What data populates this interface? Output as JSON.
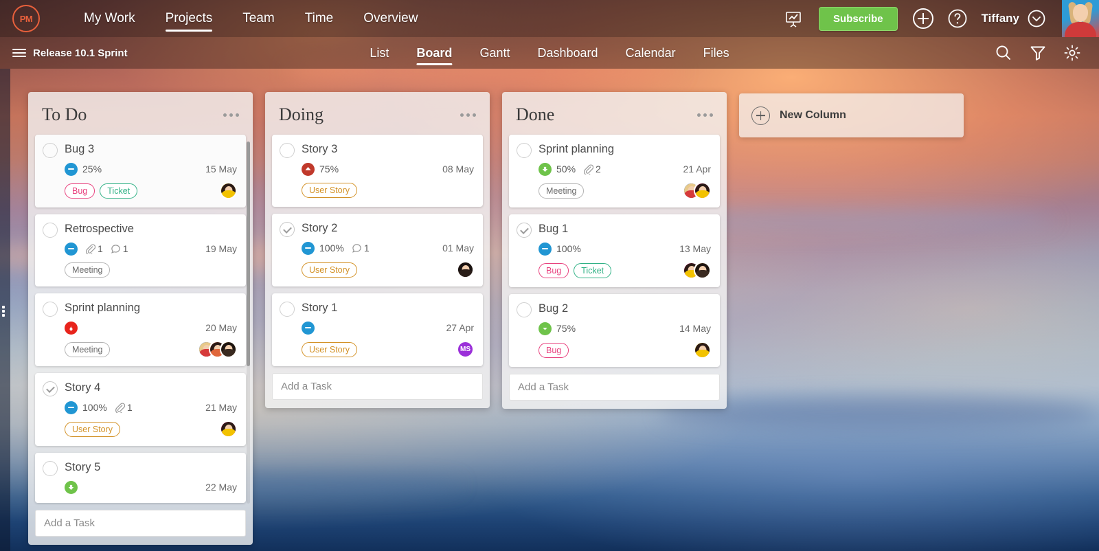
{
  "app": {
    "logo_text": "PM",
    "background": "sunset-sky-photo"
  },
  "topnav": {
    "items": [
      {
        "label": "My Work",
        "active": false
      },
      {
        "label": "Projects",
        "active": true
      },
      {
        "label": "Team",
        "active": false
      },
      {
        "label": "Time",
        "active": false
      },
      {
        "label": "Overview",
        "active": false
      }
    ],
    "report_icon": "presentation-chart-icon",
    "subscribe_label": "Subscribe",
    "add_icon": "plus-circle-icon",
    "help_icon": "question-circle-icon",
    "username": "Tiffany",
    "user_chevron_icon": "chevron-down-circle-icon",
    "avatar_icon": "user-avatar"
  },
  "projectbar": {
    "menu_icon": "hamburger-icon",
    "project_title": "Release 10.1 Sprint",
    "tabs": [
      {
        "label": "List",
        "active": false
      },
      {
        "label": "Board",
        "active": true
      },
      {
        "label": "Gantt",
        "active": false
      },
      {
        "label": "Dashboard",
        "active": false
      },
      {
        "label": "Calendar",
        "active": false
      },
      {
        "label": "Files",
        "active": false
      }
    ],
    "search_icon": "search-icon",
    "filter_icon": "filter-funnel-icon",
    "settings_icon": "gear-icon"
  },
  "board": {
    "add_task_placeholder": "Add a Task",
    "new_column": {
      "label": "New Column",
      "icon": "plus-circle-icon"
    },
    "columns": [
      {
        "title": "To Do",
        "menu_icon": "more-dots-icon",
        "has_scrollbar": true,
        "cards": [
          {
            "title": "Bug 3",
            "completed": false,
            "tinted": true,
            "priority": {
              "name": "medium",
              "icon": "minus-circle-icon",
              "color": "#2196d3"
            },
            "progress": "25%",
            "attachments": null,
            "comments": null,
            "date": "15 May",
            "tags": [
              {
                "label": "Bug",
                "style": "bug"
              },
              {
                "label": "Ticket",
                "style": "ticket"
              }
            ],
            "avatars": [
              {
                "type": "photo",
                "hair": "#2b1a16",
                "shirt": "#f2c200",
                "bg": "#f2c200"
              }
            ]
          },
          {
            "title": "Retrospective",
            "completed": false,
            "tinted": false,
            "priority": {
              "name": "medium",
              "icon": "minus-circle-icon",
              "color": "#2196d3"
            },
            "progress": null,
            "attachments": "1",
            "comments": "1",
            "date": "19 May",
            "tags": [
              {
                "label": "Meeting",
                "style": "meeting"
              }
            ],
            "avatars": []
          },
          {
            "title": "Sprint planning",
            "completed": false,
            "tinted": false,
            "priority": {
              "name": "critical",
              "icon": "flame-circle-icon",
              "color": "#e8241c"
            },
            "progress": null,
            "attachments": null,
            "comments": null,
            "date": "20 May",
            "tags": [
              {
                "label": "Meeting",
                "style": "meeting"
              }
            ],
            "avatars": [
              {
                "type": "photo",
                "hair": "#e8c98a",
                "shirt": "#d63a3a",
                "bg": "#4a6fa5"
              },
              {
                "type": "photo",
                "hair": "#2b1a16",
                "shirt": "#e0663a",
                "bg": "#e0663a"
              },
              {
                "type": "photo",
                "hair": "#1d1410",
                "shirt": "#3a2a20",
                "bg": "#caa25a"
              }
            ]
          },
          {
            "title": "Story 4",
            "completed": true,
            "tinted": false,
            "priority": {
              "name": "medium",
              "icon": "minus-circle-icon",
              "color": "#2196d3"
            },
            "progress": "100%",
            "attachments": "1",
            "comments": null,
            "date": "21 May",
            "tags": [
              {
                "label": "User Story",
                "style": "userstory"
              }
            ],
            "avatars": [
              {
                "type": "photo",
                "hair": "#2b1a16",
                "shirt": "#f2c200",
                "bg": "#e8247e"
              }
            ]
          },
          {
            "title": "Story 5",
            "completed": false,
            "tinted": false,
            "priority": {
              "name": "low",
              "icon": "arrow-down-circle-icon",
              "color": "#6fc34a"
            },
            "progress": null,
            "attachments": null,
            "comments": null,
            "date": "22 May",
            "tags": [],
            "avatars": []
          }
        ]
      },
      {
        "title": "Doing",
        "menu_icon": "more-dots-icon",
        "has_scrollbar": false,
        "cards": [
          {
            "title": "Story 3",
            "completed": false,
            "tinted": false,
            "priority": {
              "name": "high",
              "icon": "arrow-up-circle-icon",
              "color": "#c0392b"
            },
            "progress": "75%",
            "attachments": null,
            "comments": null,
            "date": "08 May",
            "tags": [
              {
                "label": "User Story",
                "style": "userstory"
              }
            ],
            "avatars": []
          },
          {
            "title": "Story 2",
            "completed": true,
            "tinted": false,
            "priority": {
              "name": "medium",
              "icon": "minus-circle-icon",
              "color": "#2196d3"
            },
            "progress": "100%",
            "attachments": null,
            "comments": "1",
            "date": "01 May",
            "tags": [
              {
                "label": "User Story",
                "style": "userstory"
              }
            ],
            "avatars": [
              {
                "type": "photo",
                "hair": "#1a1210",
                "shirt": "#2a1d18",
                "bg": "#3a2820"
              }
            ]
          },
          {
            "title": "Story 1",
            "completed": false,
            "tinted": false,
            "priority": {
              "name": "medium",
              "icon": "minus-circle-icon",
              "color": "#2196d3"
            },
            "progress": null,
            "attachments": null,
            "comments": null,
            "date": "27 Apr",
            "tags": [
              {
                "label": "User Story",
                "style": "userstory"
              }
            ],
            "avatars": [
              {
                "type": "initials",
                "initials": "MS",
                "bg": "#9b30d9"
              }
            ]
          }
        ]
      },
      {
        "title": "Done",
        "menu_icon": "more-dots-icon",
        "has_scrollbar": false,
        "cards": [
          {
            "title": "Sprint planning",
            "completed": false,
            "tinted": false,
            "priority": {
              "name": "lowish",
              "icon": "arrow-down-circle-icon",
              "color": "#6fc34a"
            },
            "progress": "50%",
            "attachments": "2",
            "comments": null,
            "date": "21 Apr",
            "tags": [
              {
                "label": "Meeting",
                "style": "meeting"
              }
            ],
            "avatars": [
              {
                "type": "photo",
                "hair": "#e8c98a",
                "shirt": "#d63a3a",
                "bg": "#4a6fa5"
              },
              {
                "type": "photo",
                "hair": "#2b1a16",
                "shirt": "#f2c200",
                "bg": "#e8247e"
              }
            ]
          },
          {
            "title": "Bug 1",
            "completed": true,
            "tinted": false,
            "priority": {
              "name": "medium",
              "icon": "minus-circle-icon",
              "color": "#2196d3"
            },
            "progress": "100%",
            "attachments": null,
            "comments": null,
            "date": "13 May",
            "tags": [
              {
                "label": "Bug",
                "style": "bug"
              },
              {
                "label": "Ticket",
                "style": "ticket"
              }
            ],
            "avatars": [
              {
                "type": "photo",
                "hair": "#2b1a16",
                "shirt": "#f2c200",
                "bg": "#e8247e"
              },
              {
                "type": "photo",
                "hair": "#1d1410",
                "shirt": "#3a2a20",
                "bg": "#caa25a"
              }
            ]
          },
          {
            "title": "Bug 2",
            "completed": false,
            "tinted": false,
            "priority": {
              "name": "low",
              "icon": "chevron-down-circle-icon",
              "color": "#6fc34a"
            },
            "progress": "75%",
            "attachments": null,
            "comments": null,
            "date": "14 May",
            "tags": [
              {
                "label": "Bug",
                "style": "bug"
              }
            ],
            "avatars": [
              {
                "type": "photo",
                "hair": "#2b1a16",
                "shirt": "#f2c200",
                "bg": "#f2c200"
              }
            ]
          }
        ]
      }
    ]
  },
  "colors": {
    "accent_green": "#6fc34a",
    "logo_orange": "#e8603c",
    "priority_medium": "#2196d3",
    "priority_high": "#c0392b",
    "priority_critical": "#e8241c",
    "priority_low": "#6fc34a",
    "tag_bug": "#e8417e",
    "tag_ticket": "#2fb185",
    "tag_userstory": "#d39227",
    "tag_meeting": "#b3b3b3"
  }
}
